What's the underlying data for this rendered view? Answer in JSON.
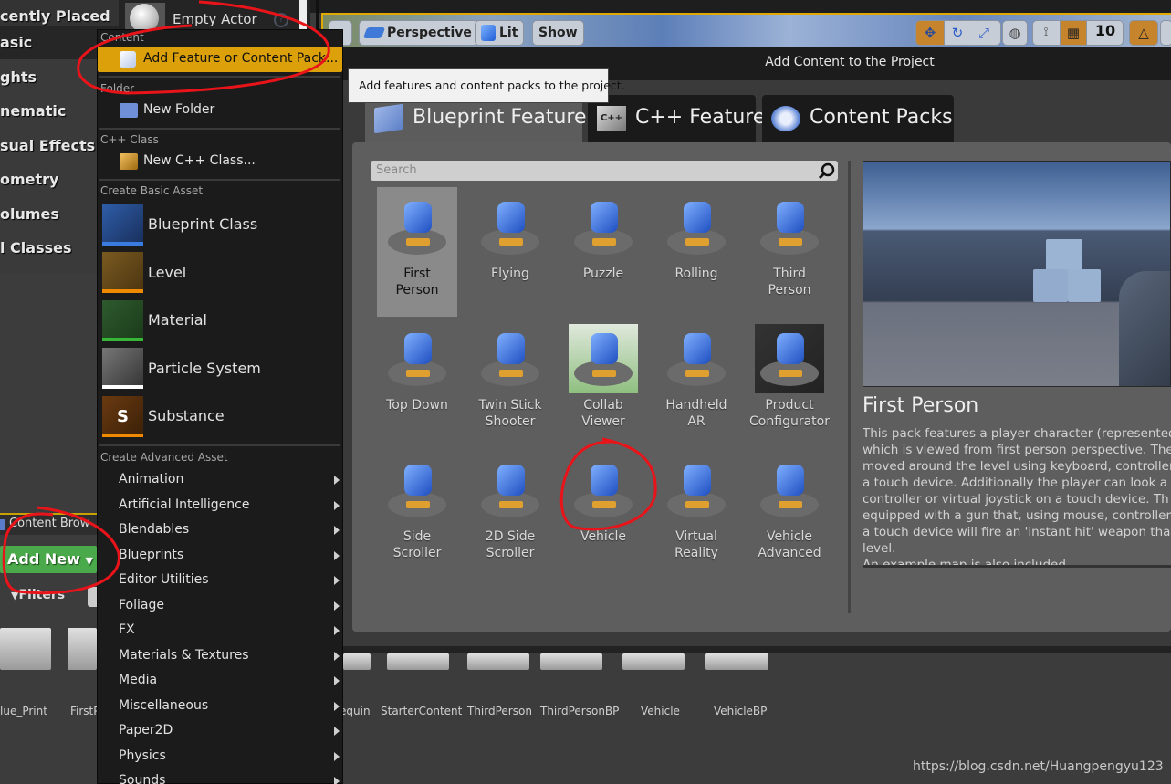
{
  "place_actors": {
    "categories": [
      {
        "label": "cently Placed"
      },
      {
        "label": "asic"
      },
      {
        "label": "ghts"
      },
      {
        "label": "nematic"
      },
      {
        "label": "sual Effects"
      },
      {
        "label": "ometry"
      },
      {
        "label": "olumes"
      },
      {
        "label": "l Classes"
      }
    ],
    "empty_actor_label": "Empty Actor"
  },
  "viewport": {
    "perspective_label": "Perspective",
    "lit_label": "Lit",
    "show_label": "Show",
    "grid_snap_value": "10"
  },
  "context_menu": {
    "sections": {
      "content": "Content",
      "folder": "Folder",
      "cpp_class": "C++ Class",
      "create_basic": "Create Basic Asset",
      "create_advanced": "Create Advanced Asset"
    },
    "add_feature": "Add Feature or Content Pack...",
    "new_folder": "New Folder",
    "new_cpp_class": "New C++ Class...",
    "basic_assets": [
      {
        "label": "Blueprint Class",
        "color": "#3a7be0"
      },
      {
        "label": "Level",
        "color": "#f08a00"
      },
      {
        "label": "Material",
        "color": "#36b536"
      },
      {
        "label": "Particle System",
        "color": "#ffffff"
      },
      {
        "label": "Substance",
        "color": "#f08a00"
      }
    ],
    "advanced_assets": [
      "Animation",
      "Artificial Intelligence",
      "Blendables",
      "Blueprints",
      "Editor Utilities",
      "Foliage",
      "FX",
      "Materials & Textures",
      "Media",
      "Miscellaneous",
      "Paper2D",
      "Physics",
      "Sounds"
    ]
  },
  "tooltip": "Add features and content packs to the project.",
  "dialog": {
    "title": "Add Content to the Project",
    "tabs": [
      {
        "label": "Blueprint Feature",
        "active": true
      },
      {
        "label": "C++ Feature",
        "active": false
      },
      {
        "label": "Content Packs",
        "active": false
      }
    ],
    "search_placeholder": "Search",
    "templates": [
      {
        "line1": "First",
        "line2": "Person",
        "selected": true
      },
      {
        "line1": "Flying",
        "line2": ""
      },
      {
        "line1": "Puzzle",
        "line2": ""
      },
      {
        "line1": "Rolling",
        "line2": ""
      },
      {
        "line1": "Third",
        "line2": "Person"
      },
      {
        "line1": "Top Down",
        "line2": ""
      },
      {
        "line1": "Twin Stick",
        "line2": "Shooter"
      },
      {
        "line1": "Collab",
        "line2": "Viewer"
      },
      {
        "line1": "Handheld",
        "line2": "AR"
      },
      {
        "line1": "Product",
        "line2": "Configurator"
      },
      {
        "line1": "Side",
        "line2": "Scroller"
      },
      {
        "line1": "2D Side",
        "line2": "Scroller"
      },
      {
        "line1": "Vehicle",
        "line2": ""
      },
      {
        "line1": "Virtual",
        "line2": "Reality"
      },
      {
        "line1": "Vehicle",
        "line2": "Advanced"
      }
    ],
    "preview": {
      "title": "First Person",
      "description_lines": [
        "This pack features a player character (represented",
        "which is viewed from first person perspective. The",
        "moved around the level using keyboard, controller",
        "a touch device. Additionally the player can look a",
        "controller or virtual joystick on a touch device. Th",
        "equipped with a gun that, using mouse, controller",
        "a touch device will fire an 'instant hit' weapon tha",
        "level.",
        "An example map is also included."
      ]
    }
  },
  "content_browser": {
    "tab_label": "Content Brow",
    "add_new_label": "Add New",
    "filters_label": "Filters",
    "folders": [
      "lue_Print",
      "FirstP",
      "equin",
      "StarterContent",
      "ThirdPerson",
      "ThirdPersonBP",
      "Vehicle",
      "VehicleBP"
    ]
  },
  "watermark": "https://blog.csdn.net/Huangpengyu123",
  "colors": {
    "menu_highlight": "#dba00a",
    "add_new_green": "#4aa94a",
    "annotation_red": "#e8141a"
  }
}
